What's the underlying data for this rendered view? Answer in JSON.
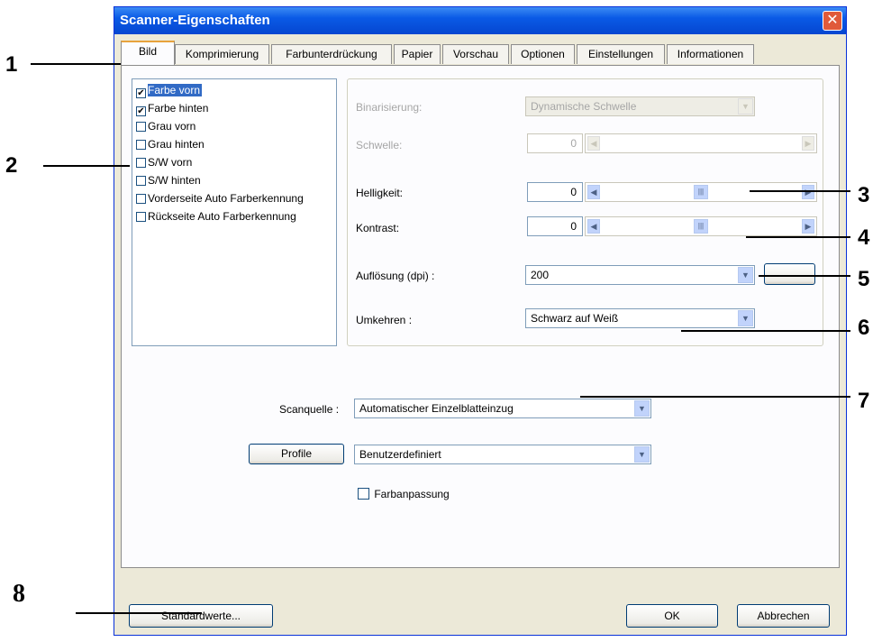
{
  "window": {
    "title": "Scanner-Eigenschaften",
    "close_glyph": "✕",
    "tabs": [
      {
        "label": "Bild",
        "active": true
      },
      {
        "label": "Komprimierung"
      },
      {
        "label": "Farbunterdrückung"
      },
      {
        "label": "Papier"
      },
      {
        "label": "Vorschau"
      },
      {
        "label": "Optionen"
      },
      {
        "label": "Einstellungen"
      },
      {
        "label": "Informationen"
      }
    ]
  },
  "image_list": {
    "items": [
      {
        "label": "Farbe vorn",
        "checked": true,
        "selected": true
      },
      {
        "label": "Farbe hinten",
        "checked": true
      },
      {
        "label": "Grau vorn",
        "checked": false
      },
      {
        "label": "Grau hinten",
        "checked": false
      },
      {
        "label": "S/W vorn",
        "checked": false
      },
      {
        "label": "S/W hinten",
        "checked": false
      },
      {
        "label": "Vorderseite Auto Farberkennung",
        "checked": false
      },
      {
        "label": "Rückseite Auto Farberkennung",
        "checked": false
      }
    ],
    "check_glyph": "✔"
  },
  "settings": {
    "binarization_label": "Binarisierung:",
    "binarization_value": "Dynamische Schwelle",
    "threshold_label": "Schwelle:",
    "threshold_value": "0",
    "brightness_label": "Helligkeit:",
    "brightness_value": "0",
    "contrast_label": "Kontrast:",
    "contrast_value": "0",
    "resolution_label": "Auflösung (dpi) :",
    "resolution_value": "200",
    "resolution_more_label": "...",
    "invert_label": "Umkehren :",
    "invert_value": "Schwarz auf Weiß"
  },
  "bottom": {
    "scan_source_label": "Scanquelle :",
    "scan_source_value": "Automatischer Einzelblatteinzug",
    "profile_button": "Profile",
    "profile_value": "Benutzerdefiniert",
    "color_match_label": "Farbanpassung",
    "defaults_button": "Standardwerte...",
    "ok_button": "OK",
    "cancel_button": "Abbrechen"
  },
  "glyphs": {
    "left": "◀",
    "right": "▶",
    "thumb": "|||",
    "down": "▼"
  },
  "callouts": [
    "1",
    "2",
    "3",
    "4",
    "5",
    "6",
    "7",
    "8"
  ],
  "colors": {
    "titlebar": "#0a5ae6",
    "selection": "#316ac5",
    "dialog_bg": "#ece9d8"
  }
}
